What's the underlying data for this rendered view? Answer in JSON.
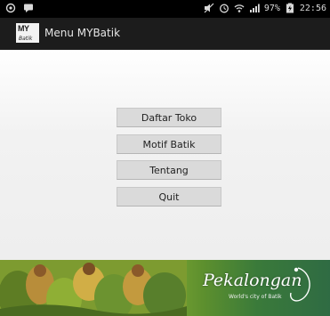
{
  "status_bar": {
    "battery": "97%",
    "time": "22:56",
    "icons": [
      "circle-icon",
      "chat-icon",
      "mute-icon",
      "alarm-icon",
      "wifi-icon",
      "signal-icon",
      "battery-icon"
    ]
  },
  "action_bar": {
    "title": "Menu MYBatik",
    "logo_text": "MY",
    "logo_sub": "Batik"
  },
  "menu": {
    "items": [
      {
        "label": "Daftar Toko"
      },
      {
        "label": "Motif Batik"
      },
      {
        "label": "Tentang"
      },
      {
        "label": "Quit"
      }
    ]
  },
  "banner": {
    "brand": "Pekalongan",
    "tagline": "World's city of Batik"
  }
}
